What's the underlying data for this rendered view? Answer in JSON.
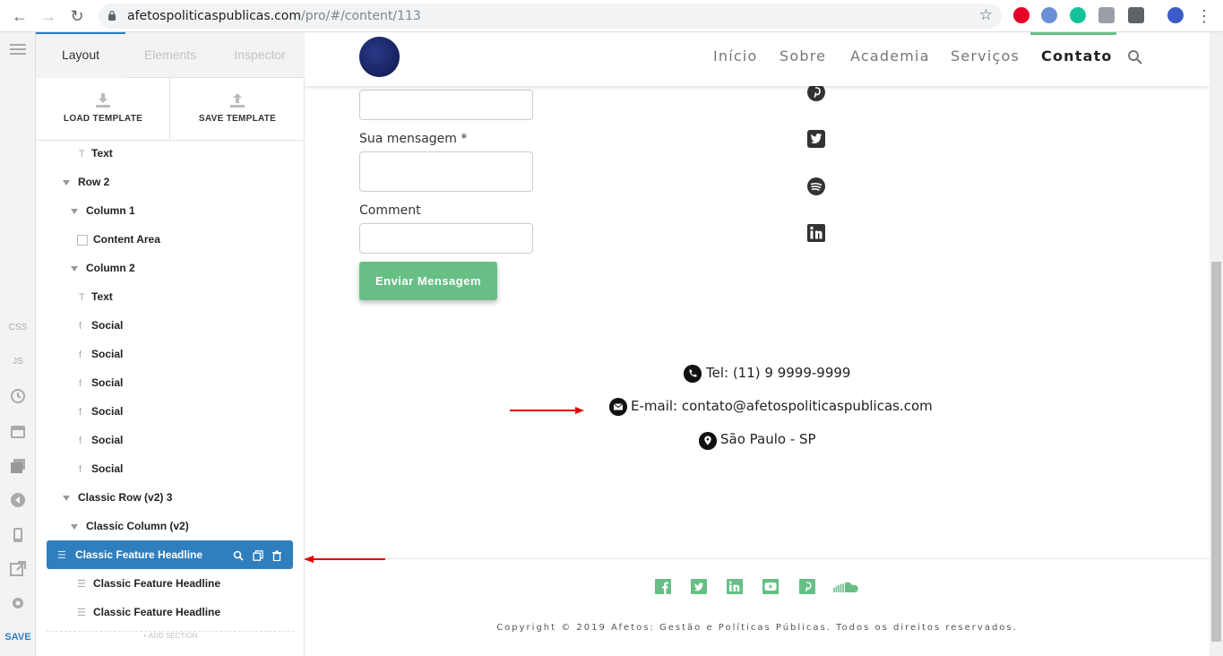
{
  "browser": {
    "url_host": "afetospoliticaspublicas.com",
    "url_path": "/pro/#/content/113"
  },
  "toolbar": {
    "css_label": "CSS",
    "js_label": "JS",
    "save_label": "SAVE"
  },
  "sidebar": {
    "tabs": [
      {
        "label": "Layout",
        "active": true
      },
      {
        "label": "Elements",
        "active": false
      },
      {
        "label": "Inspector",
        "active": false
      }
    ],
    "load_template": "LOAD TEMPLATE",
    "save_template": "SAVE TEMPLATE",
    "tree": [
      {
        "label": "Text",
        "icon": "text-icon"
      },
      {
        "label": "Row 2",
        "icon": "collapse-arrow-icon"
      },
      {
        "label": "Column 1",
        "icon": "collapse-arrow-icon"
      },
      {
        "label": "Content Area",
        "icon": "checkbox-icon"
      },
      {
        "label": "Column 2",
        "icon": "collapse-arrow-icon"
      },
      {
        "label": "Text",
        "icon": "text-icon"
      },
      {
        "label": "Social",
        "icon": "social-icon"
      },
      {
        "label": "Social",
        "icon": "social-icon"
      },
      {
        "label": "Social",
        "icon": "social-icon"
      },
      {
        "label": "Social",
        "icon": "social-icon"
      },
      {
        "label": "Social",
        "icon": "social-icon"
      },
      {
        "label": "Social",
        "icon": "social-icon"
      },
      {
        "label": "Classic Row (v2) 3",
        "icon": "collapse-arrow-icon"
      },
      {
        "label": "Classic Column (v2)",
        "icon": "collapse-arrow-icon"
      },
      {
        "label": "Classic Feature Headline",
        "icon": "feature-icon",
        "selected": true
      },
      {
        "label": "Classic Feature Headline",
        "icon": "feature-icon"
      },
      {
        "label": "Classic Feature Headline",
        "icon": "feature-icon"
      }
    ],
    "add_section": "+ ADD SECTION"
  },
  "site": {
    "nav": [
      "Início",
      "Sobre",
      "Academia",
      "Serviços",
      "Contato"
    ],
    "active_nav": "Contato",
    "form": {
      "message_label": "Sua mensagem *",
      "comment_label": "Comment",
      "send_label": "Enviar Mensagem"
    },
    "social_icons": [
      "pinterest-icon",
      "twitter-icon",
      "spotify-icon",
      "linkedin-icon"
    ],
    "contact": {
      "phone": "Tel: (11) 9 9999-9999",
      "email": "E-mail: contato@afetospoliticaspublicas.com",
      "location": "São Paulo - SP"
    },
    "footer_icons": [
      "facebook-icon",
      "twitter-icon",
      "linkedin-icon",
      "youtube-icon",
      "pinterest-icon",
      "soundcloud-icon"
    ],
    "copyright": "Copyright © 2019 Afetos: Gestão e Políticas Públicas. Todos os direitos reservados."
  },
  "colors": {
    "accent": "#2f7fbf",
    "brand_green": "#67bf86",
    "arrow_red": "#e00000"
  }
}
